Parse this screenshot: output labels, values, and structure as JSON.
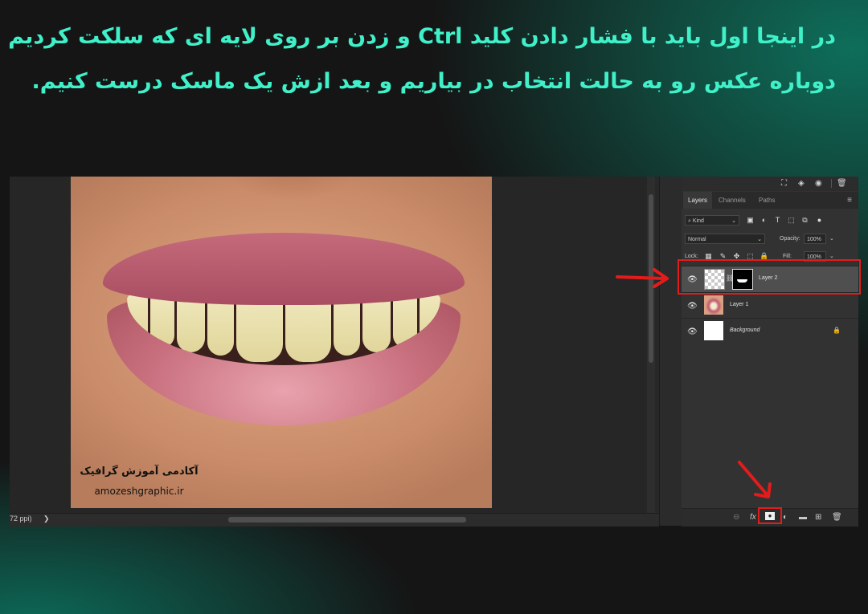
{
  "headline": {
    "line1": "در اینجا اول باید با فشار دادن کلید Ctrl و زدن بر روی لایه ای که سلکت کردیم ،",
    "line2": "دوباره عکس رو به حالت انتخاب در بیاریم و بعد ازش یک ماسک درست کنیم."
  },
  "canvas": {
    "watermark_fa": "آکادمی آموزش گرافیک",
    "watermark_url": "amozeshgraphic.ir"
  },
  "status_bar": {
    "zoom_text": "72 ppi)",
    "arrow": "❯"
  },
  "layers_panel": {
    "tabs": [
      {
        "label": "Layers",
        "active": true
      },
      {
        "label": "Channels",
        "active": false
      },
      {
        "label": "Paths",
        "active": false
      }
    ],
    "filter_kind": "Kind",
    "blend_mode": "Normal",
    "opacity_label": "Opacity:",
    "opacity_value": "100%",
    "lock_label": "Lock:",
    "fill_label": "Fill:",
    "fill_value": "100%",
    "layers": [
      {
        "name": "Layer 2",
        "selected": true,
        "has_mask": true
      },
      {
        "name": "Layer 1",
        "selected": false,
        "has_mask": false
      },
      {
        "name": "Background",
        "selected": false,
        "has_mask": false,
        "locked": true
      }
    ],
    "bottom_icons": [
      "link-icon",
      "fx-icon",
      "add-mask-icon",
      "adjustment-icon",
      "folder-icon",
      "new-layer-icon",
      "trash-icon"
    ]
  },
  "colors": {
    "headline": "#3ff0c8",
    "highlight": "#e41b1b",
    "panel_bg": "#323232"
  }
}
